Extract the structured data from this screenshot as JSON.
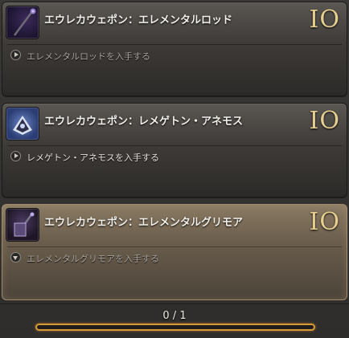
{
  "quests": [
    {
      "title": "エウレカウェポン：エレメンタルロッド",
      "reward": "IO",
      "objective": "エレメンタルロッドを入手する",
      "icon": "rod-icon",
      "selected": false
    },
    {
      "title": "エウレカウェポン：レメゲトン・アネモス",
      "reward": "IO",
      "objective": "レメゲトン・アネモスを入手する",
      "icon": "book-icon",
      "selected": false
    },
    {
      "title": "エウレカウェポン：エレメンタルグリモア",
      "reward": "IO",
      "objective": "エレメンタルグリモアを入手する",
      "icon": "grimoire-icon",
      "selected": true
    }
  ],
  "progress": {
    "label": "0 / 1",
    "value": 0,
    "color": "#d99a35"
  }
}
